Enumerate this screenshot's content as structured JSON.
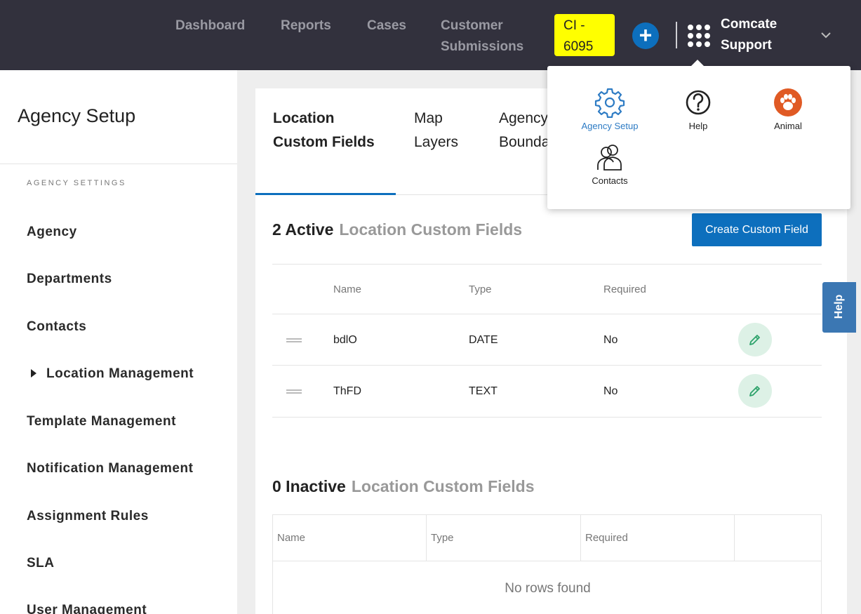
{
  "topbar": {
    "nav": [
      "Dashboard",
      "Reports",
      "Cases",
      "Customer Submissions"
    ],
    "env_badge": "CI - 6095",
    "plus_icon": "plus-icon",
    "apps_icon": "grid-icon",
    "user_name": "Comcate Support",
    "chevron": "⌄"
  },
  "dropdown": {
    "items": [
      {
        "label": "Agency Setup",
        "icon": "gear-icon"
      },
      {
        "label": "Help",
        "icon": "question-icon"
      },
      {
        "label": "Animal",
        "icon": "paw-icon"
      },
      {
        "label": "Contacts",
        "icon": "contacts-icon"
      }
    ]
  },
  "sidebar": {
    "title": "Agency Setup",
    "section_label": "AGENCY SETTINGS",
    "items": [
      "Agency",
      "Departments",
      "Contacts",
      "Location Management",
      "Template Management",
      "Notification Management",
      "Assignment Rules",
      "SLA",
      "User Management"
    ]
  },
  "tabs": [
    {
      "line1": "Location",
      "line2": "Custom Fields"
    },
    {
      "line1": "Map",
      "line2": "Layers"
    },
    {
      "line1": "Agency",
      "line2": "Bounda"
    }
  ],
  "active_section": {
    "count_label": "2 Active",
    "sub_label": "Location Custom Fields",
    "create_button": "Create Custom Field",
    "columns": [
      "Name",
      "Type",
      "Required"
    ],
    "rows": [
      {
        "name": "bdlO",
        "type": "DATE",
        "required": "No"
      },
      {
        "name": "ThFD",
        "type": "TEXT",
        "required": "No"
      }
    ]
  },
  "inactive_section": {
    "count_label": "0 Inactive",
    "sub_label": "Location Custom Fields",
    "columns": [
      "Name",
      "Type",
      "Required"
    ],
    "empty_text": "No rows found"
  },
  "help_tab": "Help",
  "colors": {
    "topbar": "#32313d",
    "accent": "#0d6fbd",
    "env_badge": "#ffff00",
    "edit_bg": "#ddf1e6",
    "edit_icon": "#2ea36b",
    "paw": "#e05a24"
  }
}
